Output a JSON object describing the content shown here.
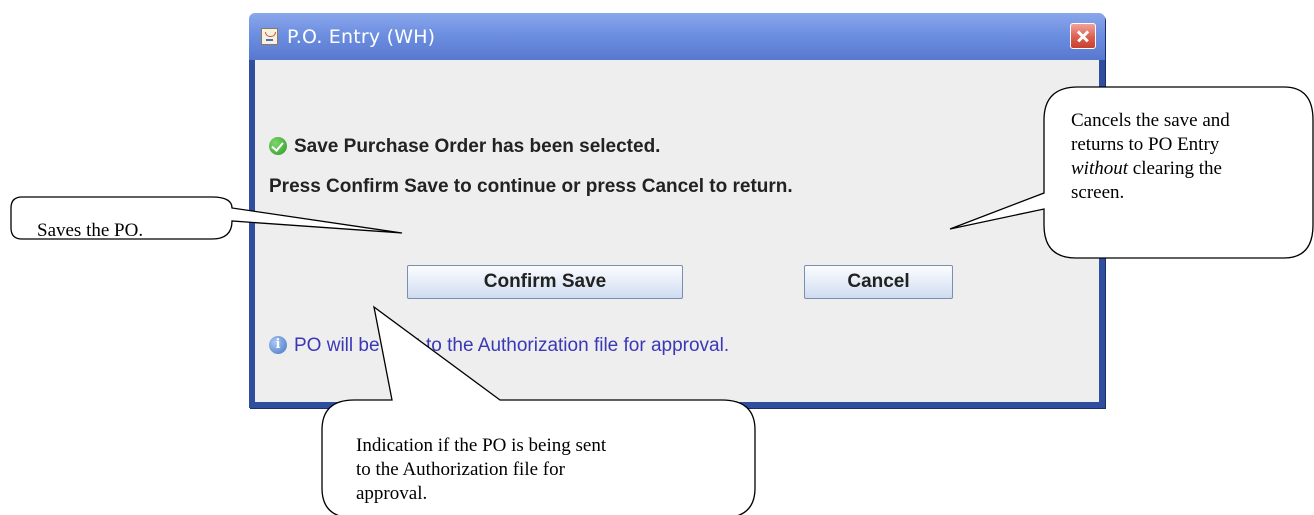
{
  "dialog": {
    "title": "P.O. Entry (WH)",
    "app_icon": "java-cup-icon",
    "close_icon": "close-icon",
    "message_primary": "Save Purchase Order has been selected.",
    "message_secondary": "Press Confirm Save to continue or press Cancel to return.",
    "confirm_label": "Confirm Save",
    "cancel_label": "Cancel",
    "info_message": "PO will be sent to the Authorization file for approval.",
    "status_icon": "check-circle-icon",
    "info_icon": "info-icon",
    "info_glyph": "i",
    "colors": {
      "title_bar": "#6d8fe1",
      "frame": "#2f4f9e",
      "close_button": "#dc5e4f",
      "success_icon": "#2c9a27",
      "info_text": "#3a38b5",
      "content_background": "#eeeeee"
    }
  },
  "annotations": {
    "saves": {
      "text": "Saves the PO."
    },
    "cancels": {
      "line1": "Cancels the save and",
      "line2": "returns to PO Entry",
      "line3_italic": "without",
      "line3_rest": " clearing the",
      "line4": "screen."
    },
    "indication": {
      "line1": "Indication if the PO is being sent",
      "line2": "to the Authorization file for",
      "line3": "approval."
    }
  }
}
